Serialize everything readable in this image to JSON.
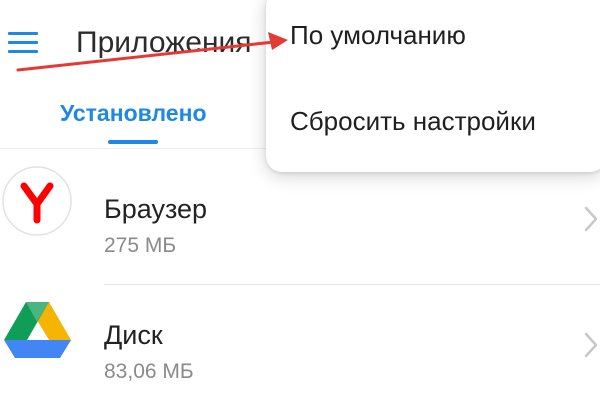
{
  "header": {
    "title": "Приложения",
    "menu_icon": "hamburger-menu-icon"
  },
  "tabs": [
    {
      "label": "Установлено",
      "active": true
    }
  ],
  "apps": [
    {
      "name": "Браузер",
      "size": "275 МБ",
      "icon": "yandex-browser-icon"
    },
    {
      "name": "Диск",
      "size": "83,06 МБ",
      "icon": "google-drive-icon"
    }
  ],
  "dropdown_menu": {
    "items": [
      {
        "label": "По умолчанию"
      },
      {
        "label": "Сбросить настройки"
      }
    ]
  },
  "annotation": {
    "type": "arrow",
    "color": "#e53935"
  },
  "colors": {
    "accent": "#1e88e5",
    "annotation_red": "#e53935",
    "yandex_red": "#ff0000",
    "drive_green": "#0f9d58",
    "drive_yellow": "#f4b400",
    "drive_blue": "#4285f4"
  }
}
